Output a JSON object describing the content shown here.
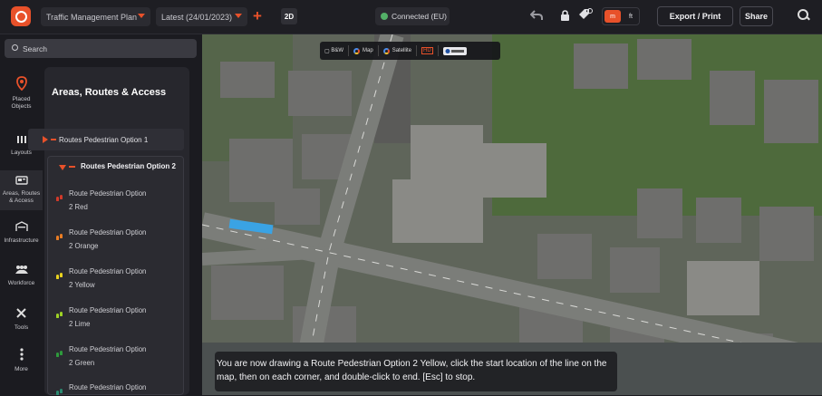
{
  "topbar": {
    "project_select": "Traffic Management Plan",
    "version_select": "Latest (24/01/2023)",
    "add_label": "+",
    "view_mode": "2D",
    "connection_status": "Connected (EU)",
    "unit_metric": "m",
    "unit_imperial": "ft",
    "export_label": "Export / Print",
    "share_label": "Share",
    "accent_color": "#e8512a",
    "connected_color": "#53b068"
  },
  "search": {
    "placeholder": "Search"
  },
  "rail": [
    {
      "label_line1": "Placed",
      "label_line2": "Objects",
      "icon": "map-pin-icon"
    },
    {
      "label_line1": "Layouts",
      "label_line2": "",
      "icon": "layouts-icon"
    },
    {
      "label_line1": "Areas, Routes",
      "label_line2": "& Access",
      "icon": "areas-icon"
    },
    {
      "label_line1": "Infrastructure",
      "label_line2": "",
      "icon": "infrastructure-icon"
    },
    {
      "label_line1": "Workforce",
      "label_line2": "",
      "icon": "workforce-icon"
    },
    {
      "label_line1": "Tools",
      "label_line2": "",
      "icon": "tools-icon"
    },
    {
      "label_line1": "More",
      "label_line2": "",
      "icon": "more-icon"
    }
  ],
  "panel": {
    "title": "Areas, Routes & Access",
    "route_option_1": "Routes Pedestrian Option 1",
    "route_option_2": "Routes Pedestrian Option 2",
    "sub_routes": [
      {
        "line1": "Route Pedestrian Option",
        "line2": "2 Red",
        "color": "#d23a2a"
      },
      {
        "line1": "Route Pedestrian Option",
        "line2": "2 Orange",
        "color": "#ea7d24"
      },
      {
        "line1": "Route Pedestrian Option",
        "line2": "2 Yellow",
        "color": "#e9d21f"
      },
      {
        "line1": "Route Pedestrian Option",
        "line2": "2 Lime",
        "color": "#9ed225"
      },
      {
        "line1": "Route Pedestrian Option",
        "line2": "2 Green",
        "color": "#2e9a3c"
      },
      {
        "line1": "Route Pedestrian Option",
        "line2": "",
        "color": "#2a8a70"
      }
    ]
  },
  "map": {
    "tile_options": [
      "B&W",
      "Map",
      "Satellite",
      "HD"
    ],
    "hint": "You are now drawing a Route Pedestrian Option 2 Yellow, click the start location of the line on the map, then on each corner, and double-click to end. [Esc] to stop."
  }
}
